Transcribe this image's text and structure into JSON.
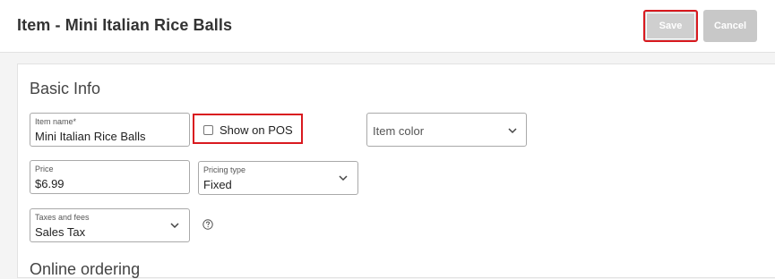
{
  "header": {
    "title": "Item - Mini Italian Rice Balls",
    "save_label": "Save",
    "cancel_label": "Cancel"
  },
  "basic_info": {
    "title": "Basic Info",
    "item_name": {
      "label": "Item name*",
      "value": "Mini Italian Rice Balls"
    },
    "show_on_pos": {
      "label": "Show on POS",
      "checked": false
    },
    "item_color": {
      "placeholder": "Item color",
      "icon": "chevron-down-icon"
    },
    "price": {
      "label": "Price",
      "value": "$6.99"
    },
    "pricing_type": {
      "label": "Pricing type",
      "value": "Fixed",
      "icon": "chevron-down-icon"
    },
    "taxes_and_fees": {
      "label": "Taxes and fees",
      "value": "Sales Tax",
      "icon": "chevron-down-icon"
    },
    "help_icon": "question-circle-icon"
  },
  "online_ordering": {
    "title": "Online ordering"
  },
  "colors": {
    "highlight_border": "#d9191f",
    "button_disabled": "#cfcfcf"
  }
}
